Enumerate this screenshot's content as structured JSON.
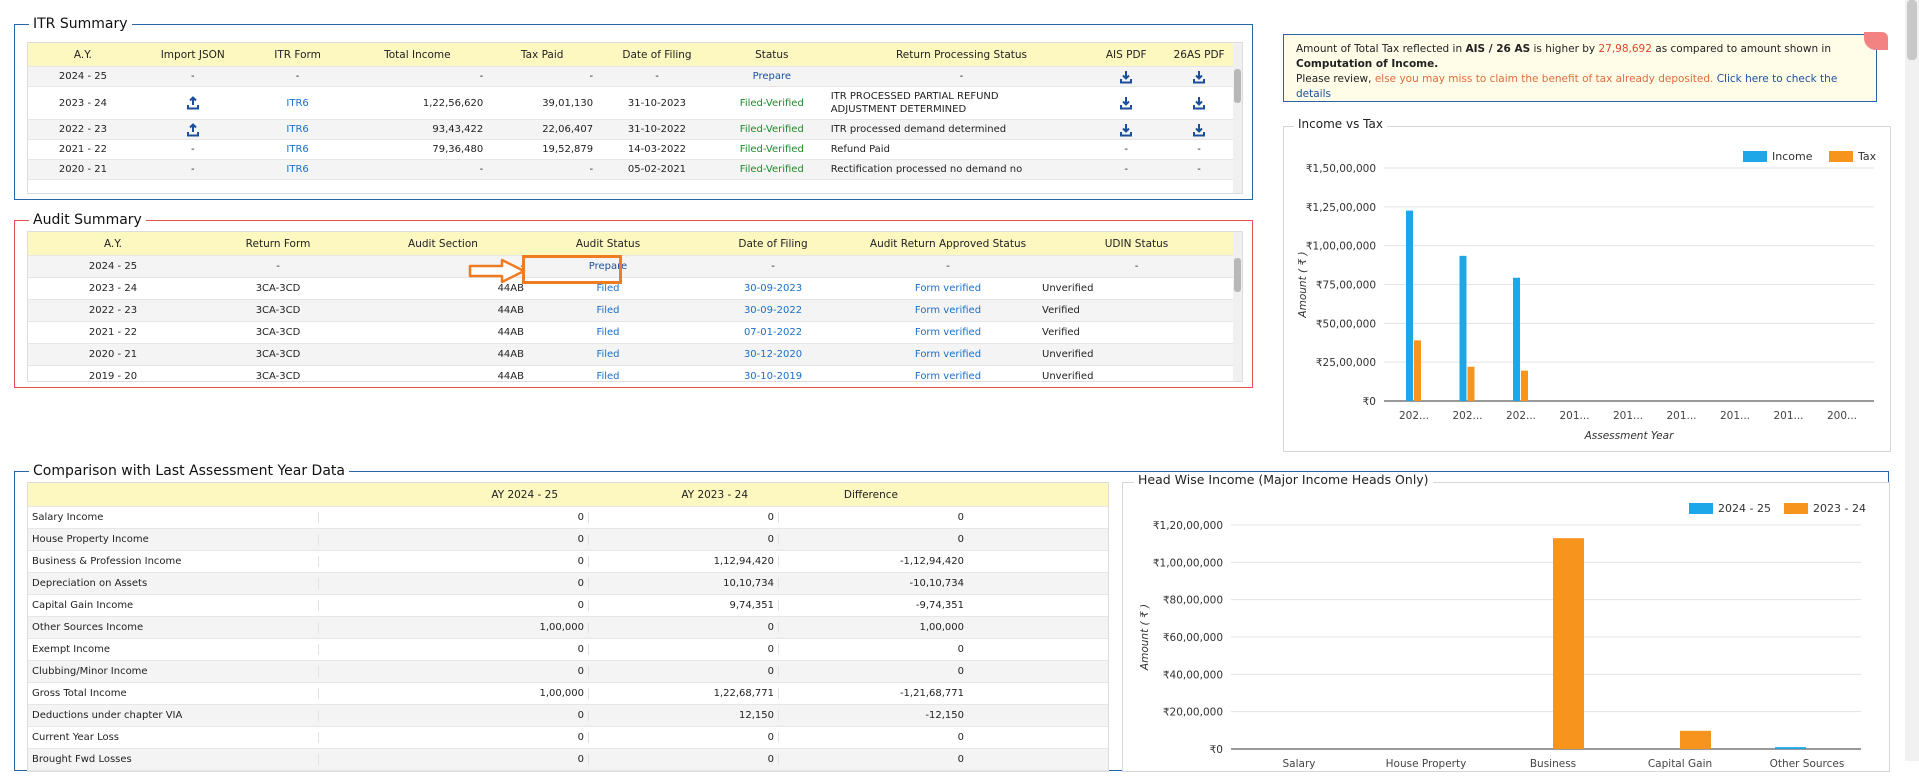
{
  "itr": {
    "title": "ITR Summary",
    "headers": [
      "A.Y.",
      "Import JSON",
      "ITR Form",
      "Total Income",
      "Tax Paid",
      "Date of Filing",
      "Status",
      "Return Processing Status",
      "AIS PDF",
      "26AS PDF"
    ],
    "rows": [
      {
        "ay": "2024 - 25",
        "import": "-",
        "form": "-",
        "income": "-",
        "tax": "-",
        "date": "-",
        "status": "Prepare",
        "processing": "-",
        "ais": "download",
        "as26": "download"
      },
      {
        "ay": "2023 - 24",
        "import": "upload",
        "form": "ITR6",
        "income": "1,22,56,620",
        "tax": "39,01,130",
        "date": "31-10-2023",
        "status": "Filed-Verified",
        "processing": "ITR PROCESSED PARTIAL REFUND",
        "processing2": "ADJUSTMENT DETERMINED",
        "ais": "download",
        "as26": "download"
      },
      {
        "ay": "2022 - 23",
        "import": "upload",
        "form": "ITR6",
        "income": "93,43,422",
        "tax": "22,06,407",
        "date": "31-10-2022",
        "status": "Filed-Verified",
        "processing": "ITR processed demand determined",
        "ais": "download",
        "as26": "download"
      },
      {
        "ay": "2021 - 22",
        "import": "-",
        "form": "ITR6",
        "income": "79,36,480",
        "tax": "19,52,879",
        "date": "14-03-2022",
        "status": "Filed-Verified",
        "processing": "Refund Paid",
        "ais": "-",
        "as26": "-"
      },
      {
        "ay": "2020 - 21",
        "import": "-",
        "form": "ITR6",
        "income": "-",
        "tax": "-",
        "date": "05-02-2021",
        "status": "Filed-Verified",
        "processing": "Rectification processed no demand no",
        "ais": "-",
        "as26": "-"
      }
    ]
  },
  "audit": {
    "title": "Audit Summary",
    "headers": [
      "A.Y.",
      "Return Form",
      "Audit Section",
      "Audit Status",
      "Date of Filing",
      "Audit Return Approved Status",
      "UDIN Status"
    ],
    "rows": [
      {
        "ay": "2024 - 25",
        "form": "-",
        "section": "-",
        "status": "Prepare",
        "date": "-",
        "approved": "-",
        "udin": "-"
      },
      {
        "ay": "2023 - 24",
        "form": "3CA-3CD",
        "section": "44AB",
        "status": "Filed",
        "date": "30-09-2023",
        "approved": "Form verified",
        "udin": "Unverified"
      },
      {
        "ay": "2022 - 23",
        "form": "3CA-3CD",
        "section": "44AB",
        "status": "Filed",
        "date": "30-09-2022",
        "approved": "Form verified",
        "udin": "Verified"
      },
      {
        "ay": "2021 - 22",
        "form": "3CA-3CD",
        "section": "44AB",
        "status": "Filed",
        "date": "07-01-2022",
        "approved": "Form verified",
        "udin": "Verified"
      },
      {
        "ay": "2020 - 21",
        "form": "3CA-3CD",
        "section": "44AB",
        "status": "Filed",
        "date": "30-12-2020",
        "approved": "Form verified",
        "udin": "Unverified"
      },
      {
        "ay": "2019 - 20",
        "form": "3CA-3CD",
        "section": "44AB",
        "status": "Filed",
        "date": "30-10-2019",
        "approved": "Form verified",
        "udin": "Unverified"
      }
    ]
  },
  "info": {
    "p1": "Amount of Total Tax reflected in ",
    "b1": "AIS / 26 AS",
    "p2": " is higher by ",
    "amount": "27,98,692",
    "p3": " as compared to amount shown in ",
    "b2": "Computation of Income.",
    "p4": "Please review, ",
    "warn": "else you may miss to claim the benefit of tax already deposited.",
    "link": " Click here to check the details"
  },
  "comparison": {
    "title": "Comparison with Last Assessment Year Data",
    "headers": [
      "",
      "AY 2024 - 25",
      "AY 2023 - 24",
      "Difference"
    ],
    "rows": [
      [
        "Salary Income",
        "0",
        "0",
        "0"
      ],
      [
        "House Property Income",
        "0",
        "0",
        "0"
      ],
      [
        "Business & Profession Income",
        "0",
        "1,12,94,420",
        "-1,12,94,420"
      ],
      [
        "Depreciation on Assets",
        "0",
        "10,10,734",
        "-10,10,734"
      ],
      [
        "Capital Gain Income",
        "0",
        "9,74,351",
        "-9,74,351"
      ],
      [
        "Other Sources Income",
        "1,00,000",
        "0",
        "1,00,000"
      ],
      [
        "Exempt Income",
        "0",
        "0",
        "0"
      ],
      [
        "Clubbing/Minor Income",
        "0",
        "0",
        "0"
      ],
      [
        "Gross Total Income",
        "1,00,000",
        "1,22,68,771",
        "-1,21,68,771"
      ],
      [
        "Deductions under chapter VIA",
        "0",
        "12,150",
        "-12,150"
      ],
      [
        "Current Year Loss",
        "0",
        "0",
        "0"
      ],
      [
        "Brought Fwd Losses",
        "0",
        "0",
        "0"
      ]
    ]
  },
  "chart_data": [
    {
      "type": "bar",
      "title": "Income vs Tax",
      "xlabel": "Assessment Year",
      "ylabel": "Amount ( ₹ )",
      "categories": [
        "202...",
        "202...",
        "202...",
        "201...",
        "201...",
        "201...",
        "201...",
        "201...",
        "200..."
      ],
      "series": [
        {
          "name": "Income",
          "color": "#1ea7e8",
          "values": [
            12256620,
            9343422,
            7936480,
            0,
            0,
            0,
            0,
            0,
            0
          ]
        },
        {
          "name": "Tax",
          "color": "#f7941d",
          "values": [
            3901130,
            2206407,
            1952879,
            0,
            0,
            0,
            0,
            0,
            0
          ]
        }
      ],
      "ylim": [
        0,
        15000000
      ],
      "yticks": [
        "₹0",
        "₹25,00,000",
        "₹50,00,000",
        "₹75,00,000",
        "₹1,00,00,000",
        "₹1,25,00,000",
        "₹1,50,00,000"
      ],
      "legend": "top-right"
    },
    {
      "type": "bar",
      "title": "Head Wise Income (Major Income Heads Only)",
      "xlabel": "",
      "ylabel": "Amount ( ₹ )",
      "categories": [
        "Salary",
        "House Property",
        "Business",
        "Capital Gain",
        "Other Sources"
      ],
      "series": [
        {
          "name": "2024 - 25",
          "color": "#1ea7e8",
          "values": [
            0,
            0,
            0,
            0,
            100000
          ]
        },
        {
          "name": "2023 - 24",
          "color": "#f7941d",
          "values": [
            0,
            0,
            11294420,
            974351,
            0
          ]
        }
      ],
      "ylim": [
        0,
        12000000
      ],
      "yticks": [
        "₹0",
        "₹20,00,000",
        "₹40,00,000",
        "₹60,00,000",
        "₹80,00,000",
        "₹1,00,00,000",
        "₹1,20,00,000"
      ],
      "legend": "top-right"
    }
  ]
}
